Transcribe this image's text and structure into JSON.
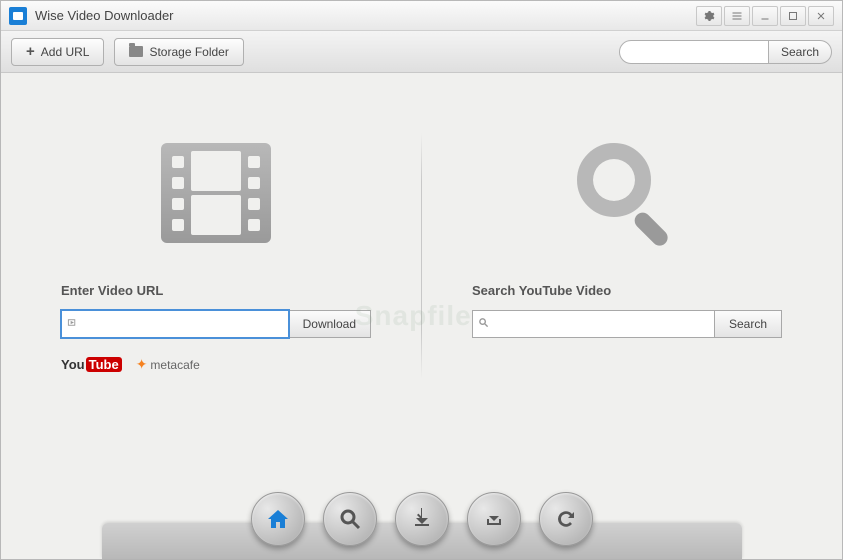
{
  "app": {
    "title": "Wise Video Downloader"
  },
  "toolbar": {
    "add_url_label": "Add URL",
    "storage_folder_label": "Storage Folder",
    "search_button": "Search",
    "search_placeholder": ""
  },
  "left_panel": {
    "heading": "Enter Video URL",
    "url_value": "",
    "download_button": "Download",
    "providers": {
      "youtube_part1": "You",
      "youtube_part2": "Tube",
      "metacafe": "metacafe"
    }
  },
  "right_panel": {
    "heading": "Search YouTube Video",
    "query_value": "",
    "search_button": "Search"
  },
  "dock": {
    "home": "home",
    "search": "search",
    "download": "download",
    "download_to": "download-to-folder",
    "refresh": "refresh"
  },
  "watermark": "Snapfiles"
}
